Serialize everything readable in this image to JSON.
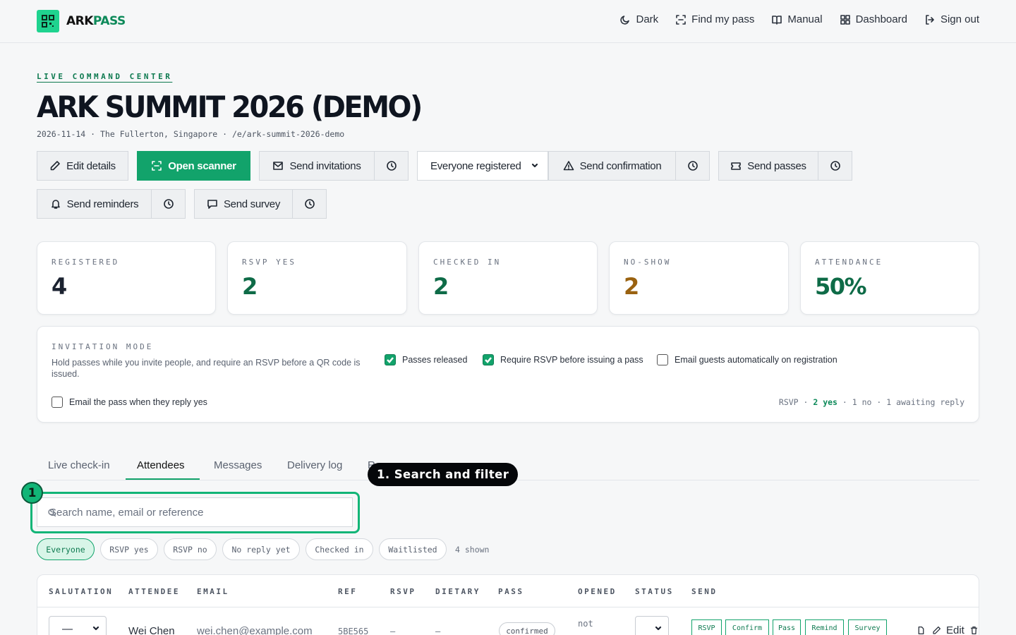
{
  "brand": {
    "name_a": "ARK",
    "name_b": "PASS",
    "accent": "#12a36b"
  },
  "nav": {
    "dark": "Dark",
    "find_pass": "Find my pass",
    "manual": "Manual",
    "dashboard": "Dashboard",
    "signout": "Sign out"
  },
  "header": {
    "eyebrow": "LIVE COMMAND CENTER",
    "title": "ARK SUMMIT 2026 (DEMO)",
    "subline": "2026-11-14 · The Fullerton, Singapore · /e/ark-summit-2026-demo"
  },
  "actions": {
    "edit": "Edit details",
    "scanner": "Open scanner",
    "invitations": "Send invitations",
    "audience": "Everyone registered",
    "confirmation": "Send confirmation",
    "passes": "Send passes",
    "reminders": "Send reminders",
    "survey": "Send survey"
  },
  "stats": {
    "registered": {
      "label": "REGISTERED",
      "value": "4",
      "color": "#1b2230"
    },
    "rsvp_yes": {
      "label": "RSVP YES",
      "value": "2",
      "color": "#0e6b47"
    },
    "checked_in": {
      "label": "CHECKED IN",
      "value": "2",
      "color": "#0e6b47"
    },
    "no_show": {
      "label": "NO-SHOW",
      "value": "2",
      "color": "#9a6210"
    },
    "attendance": {
      "label": "ATTENDANCE",
      "value": "50%",
      "color": "#0e6b47"
    }
  },
  "invitation": {
    "label": "INVITATION MODE",
    "desc": "Hold passes while you invite people, and require an RSVP before a QR code is issued.",
    "passes_released": {
      "label": "Passes released",
      "checked": true
    },
    "require_rsvp": {
      "label": "Require RSVP before issuing a pass",
      "checked": true
    },
    "email_auto": {
      "label": "Email guests automatically on registration",
      "checked": false
    },
    "email_pass": {
      "label": "Email the pass when they reply yes",
      "checked": false
    },
    "summary": {
      "prefix": "RSVP · ",
      "yes": "2 yes",
      "rest": " · 1 no · 1 awaiting reply"
    }
  },
  "tabs": [
    "Live check-in",
    "Attendees",
    "Messages",
    "Delivery log",
    "Re"
  ],
  "search": {
    "placeholder": "Search name, email or reference"
  },
  "filters": [
    "Everyone",
    "RSVP yes",
    "RSVP no",
    "No reply yet",
    "Checked in",
    "Waitlisted"
  ],
  "shown_count": "4 shown",
  "table": {
    "headers": [
      "SALUTATION",
      "ATTENDEE",
      "EMAIL",
      "REF",
      "RSVP",
      "DIETARY",
      "PASS",
      "OPENED",
      "STATUS",
      "SEND"
    ],
    "rows": [
      {
        "salutation": "—",
        "attendee": "Wei Chen",
        "email": "wei.chen@example.com",
        "ref": "5BE565",
        "rsvp": "—",
        "dietary": "—",
        "pass": "confirmed",
        "opened": "not",
        "send": [
          "RSVP",
          "Confirm",
          "Pass",
          "Remind",
          "Survey"
        ],
        "edit": "Edit"
      }
    ]
  },
  "annotation": {
    "number": "1",
    "label": "1. Search and filter"
  }
}
